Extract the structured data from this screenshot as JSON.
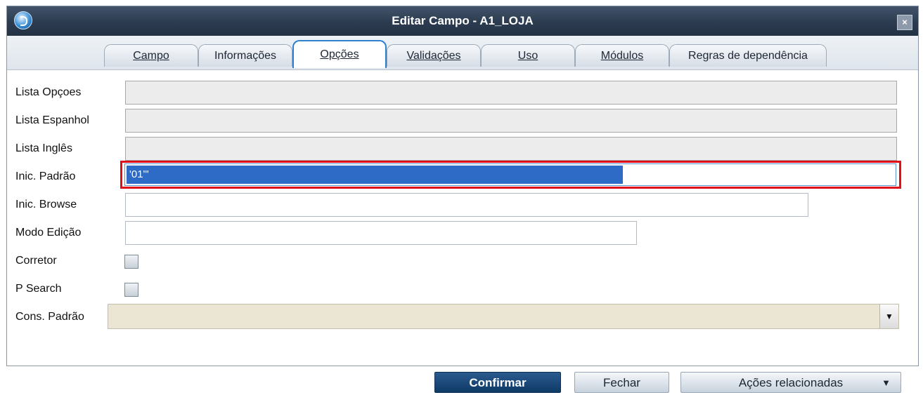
{
  "window": {
    "title": "Editar Campo - A1_LOJA",
    "close_label": "×"
  },
  "tabs": [
    {
      "label": "Campo"
    },
    {
      "label": "Informações"
    },
    {
      "label": "Opções"
    },
    {
      "label": "Validações"
    },
    {
      "label": "Uso"
    },
    {
      "label": "Módulos"
    },
    {
      "label": "Regras de dependência"
    }
  ],
  "active_tab": "Opções",
  "form": {
    "lista_opcoes": {
      "label": "Lista Opçoes",
      "value": ""
    },
    "lista_espanhol": {
      "label": "Lista Espanhol",
      "value": ""
    },
    "lista_ingles": {
      "label": "Lista Inglês",
      "value": ""
    },
    "inic_padrao": {
      "label": "Inic. Padrão",
      "value": "'01'\""
    },
    "inic_browse": {
      "label": "Inic. Browse",
      "value": ""
    },
    "modo_edicao": {
      "label": "Modo Edição",
      "value": ""
    },
    "corretor": {
      "label": "Corretor",
      "checked": false
    },
    "p_search": {
      "label": "P Search",
      "checked": false
    },
    "cons_padrao": {
      "label": "Cons. Padrão",
      "value": ""
    }
  },
  "buttons": {
    "confirm": "Confirmar",
    "close": "Fechar",
    "actions": "Ações relacionadas"
  },
  "colors": {
    "titlebar": "#2c3b4f",
    "highlight_border": "#e0101a",
    "selection": "#2e6bc6",
    "confirm_button": "#0f3a66"
  }
}
